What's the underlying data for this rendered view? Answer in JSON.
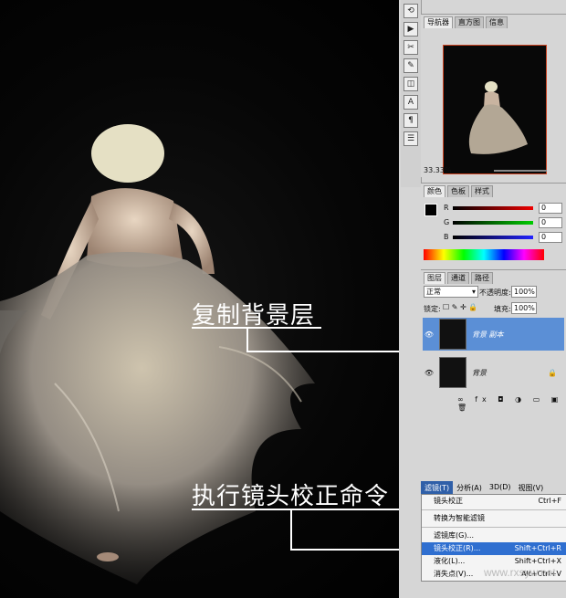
{
  "callouts": {
    "duplicate_layer": "复制背景层",
    "lens_correction": "执行镜头校正命令"
  },
  "navigator": {
    "tabs": [
      "导航器",
      "直方图",
      "信息"
    ],
    "zoom": "33.33%"
  },
  "color": {
    "tabs": [
      "颜色",
      "色板",
      "样式"
    ],
    "channels": [
      {
        "label": "R",
        "value": "0"
      },
      {
        "label": "G",
        "value": "0"
      },
      {
        "label": "B",
        "value": "0"
      }
    ]
  },
  "layers": {
    "tabs": [
      "图层",
      "通道",
      "路径"
    ],
    "blend_mode": "正常",
    "opacity_label": "不透明度:",
    "opacity_value": "100%",
    "lock_label": "锁定:",
    "fill_label": "填充:",
    "fill_value": "100%",
    "items": [
      {
        "name": "背景 副本",
        "selected": true
      },
      {
        "name": "背景",
        "selected": false
      }
    ]
  },
  "menubar": {
    "items": [
      "滤镜(T)",
      "分析(A)",
      "3D(D)",
      "视图(V)"
    ],
    "selected_index": 0
  },
  "filter_menu": {
    "items": [
      {
        "label": "镜头校正",
        "shortcut": "Ctrl+F"
      },
      {
        "label": "转换为智能滤镜",
        "shortcut": ""
      },
      {
        "label": "滤镜库(G)...",
        "shortcut": ""
      },
      {
        "label": "镜头校正(R)...",
        "shortcut": "Shift+Ctrl+R",
        "highlighted": true
      },
      {
        "label": "液化(L)...",
        "shortcut": "Shift+Ctrl+X"
      },
      {
        "label": "消失点(V)...",
        "shortcut": "Alt+Ctrl+V"
      }
    ]
  },
  "watermark": "www.rxsyw.net",
  "colors": {
    "accent": "#2f6fd0",
    "layer_selected": "#5b8fd6"
  }
}
